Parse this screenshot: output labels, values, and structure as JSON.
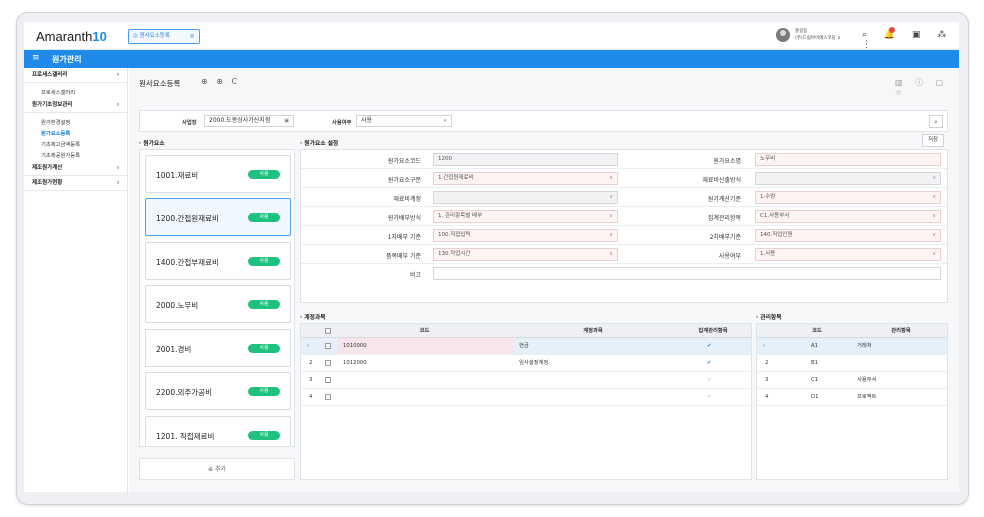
{
  "app": {
    "logo_text": "Amaranth",
    "logo_num": "10",
    "open_tab": "원사요소등록",
    "tab_close": "×"
  },
  "user": {
    "name": "홍길동",
    "org": "(주)드림아이메스코당 ∨"
  },
  "topicons": "⌕ 🔔 ▣ ⁂ ⋮",
  "module": {
    "menu_icon": "≡",
    "title": "원가관리"
  },
  "sidebar": {
    "groups": [
      {
        "label": "프로세스갤러리",
        "chev": "∧",
        "items": [
          "프로세스갤러리"
        ]
      },
      {
        "label": "원가기초정보관리",
        "chev": "∧",
        "items": [
          "원가환경설정",
          "원가요소등록",
          "기초제고금액등록",
          "기초제공원가등록"
        ]
      },
      {
        "label": "제조원가계산",
        "chev": "∨",
        "items": []
      },
      {
        "label": "제조원가현황",
        "chev": "∨",
        "items": []
      }
    ]
  },
  "page": {
    "title": "원사요소등록",
    "icons": "⊕ ⊕ C",
    "right_icons": "▥ ⓘ ▢ ☆"
  },
  "filter": {
    "site_label": "사업장",
    "site_value": "2000.도몽상사가산지점",
    "use_label": "사용여부",
    "use_value": "사용",
    "search_icon": "⌕"
  },
  "left": {
    "section": "원가요소",
    "add": "⊕ 추가"
  },
  "cards": [
    {
      "name": "1001.재료비",
      "tag": "사용"
    },
    {
      "name": "1200.간접원재료비",
      "tag": "사용"
    },
    {
      "name": "1400.간접부재료비",
      "tag": "사용"
    },
    {
      "name": "2000.노무비",
      "tag": "사용"
    },
    {
      "name": "2001.경비",
      "tag": "사용"
    },
    {
      "name": "2200.외주가공비",
      "tag": "사용"
    },
    {
      "name": "1201. 직접재료비",
      "tag": "사용"
    }
  ],
  "form": {
    "section": "원가요소 설정",
    "save": "저장",
    "fields": {
      "code_label": "원가요소코드",
      "code": "1200",
      "name_label": "원가요소명",
      "name": "노무비",
      "type_label": "원가요소구분",
      "type": "1.간접원재료비",
      "method_label": "재료비산출방식",
      "method": "",
      "account_label": "재료비계정",
      "account": "",
      "calc_label": "원가계산기준",
      "calc": "1.수량",
      "alloc_label": "원가배부방식",
      "alloc": "1. 관리항목별 배부",
      "aggr_label": "집계관리항목",
      "aggr": "C1.사용부서",
      "first_label": "1차배부 기준",
      "first": "100.직접입력",
      "second_label": "2차배부기준",
      "second": "140.직업인원",
      "item_label": "품목배부 기준",
      "item": "130.작업시간",
      "use_label": "사용여부",
      "use": "1.사용",
      "memo_label": "비고",
      "memo": ""
    }
  },
  "accounts": {
    "section": "계정과목",
    "headers": {
      "code": "코드",
      "name": "계정과목",
      "agg": "집계관리항목"
    },
    "rows": [
      {
        "no": "›",
        "code": "1010000",
        "name": "현금",
        "agg": "✔"
      },
      {
        "no": "2",
        "code": "1012000",
        "name": "임사설정계정",
        "agg": "✔"
      },
      {
        "no": "3",
        "code": "",
        "name": "",
        "agg": "✔"
      },
      {
        "no": "4",
        "code": "",
        "name": "",
        "agg": "✔"
      }
    ]
  },
  "mgmt": {
    "section": "관리항목",
    "headers": {
      "code": "코드",
      "name": "관리항목"
    },
    "rows": [
      {
        "no": "›",
        "code": "A1",
        "name": "거래처"
      },
      {
        "no": "2",
        "code": "B1",
        "name": ""
      },
      {
        "no": "3",
        "code": "C1",
        "name": "사용부서"
      },
      {
        "no": "4",
        "code": "D1",
        "name": "프로젝트"
      }
    ]
  }
}
